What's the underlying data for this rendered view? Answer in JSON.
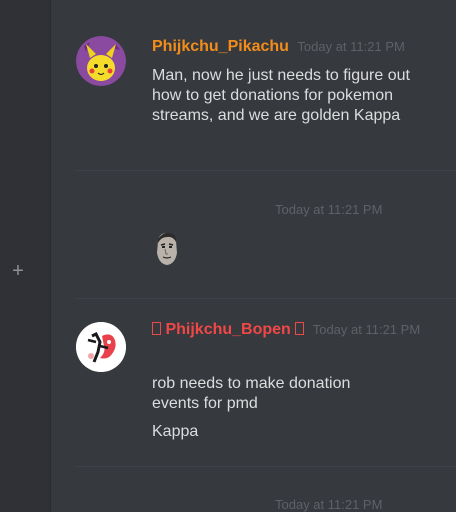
{
  "sidebar": {
    "add_label": "+"
  },
  "messages": [
    {
      "username": "Phijkchu_Pikachu",
      "username_color": "#f28d1b",
      "timestamp": "Today at 11:21 PM",
      "lines": [
        "Man, now he just needs to figure out how to get donations for pokemon streams, and we are golden Kappa"
      ]
    },
    {
      "timestamp": "Today at 11:21 PM",
      "emote": "kappa-emote"
    },
    {
      "username": "Phijkchu_Bopen",
      "username_color": "#f04747",
      "timestamp": "Today at 11:21 PM",
      "lines": [
        "rob needs to make donation events for pmd",
        "Kappa"
      ]
    },
    {
      "timestamp": "Today at 11:21 PM"
    }
  ]
}
